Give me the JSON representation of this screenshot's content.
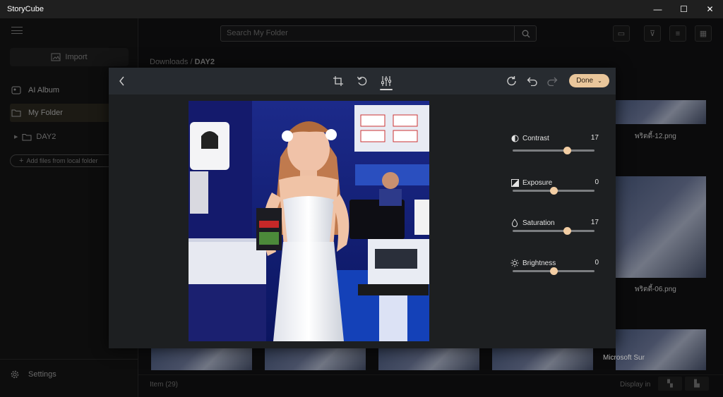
{
  "app": {
    "title": "StoryCube"
  },
  "window_controls": {
    "minimize": "—",
    "maximize": "☐",
    "close": "✕"
  },
  "sidebar": {
    "import_label": "Import",
    "items": [
      {
        "label": "AI Album",
        "icon": "ai-album-icon"
      },
      {
        "label": "My Folder",
        "icon": "folder-icon"
      }
    ],
    "tree_folder": "DAY2",
    "add_files_label": "Add files from local folder",
    "settings_label": "Settings"
  },
  "main": {
    "search_placeholder": "Search My Folder",
    "breadcrumb": {
      "root": "Downloads",
      "separator": "/",
      "current": "DAY2"
    },
    "thumb_labels": [
      "พริตตี้-12.png",
      "พริตตี้-06.png"
    ],
    "partial_label": "Microsoft Sur",
    "item_count": "Item (29)",
    "display_in_label": "Display in"
  },
  "editor": {
    "done_label": "Done",
    "adjustments": [
      {
        "label": "Contrast",
        "value": "17",
        "level": 0.66,
        "icon": "contrast-icon"
      },
      {
        "label": "Exposure",
        "value": "0",
        "level": 0.5,
        "icon": "exposure-icon"
      },
      {
        "label": "Saturation",
        "value": "17",
        "level": 0.66,
        "icon": "saturation-icon"
      },
      {
        "label": "Brightness",
        "value": "0",
        "level": 0.5,
        "icon": "brightness-icon"
      }
    ]
  },
  "colors": {
    "accent": "#e9c69b",
    "slider_track": "#7b7d80",
    "editor_bg": "#1d1f21",
    "editor_header": "#272b30"
  }
}
